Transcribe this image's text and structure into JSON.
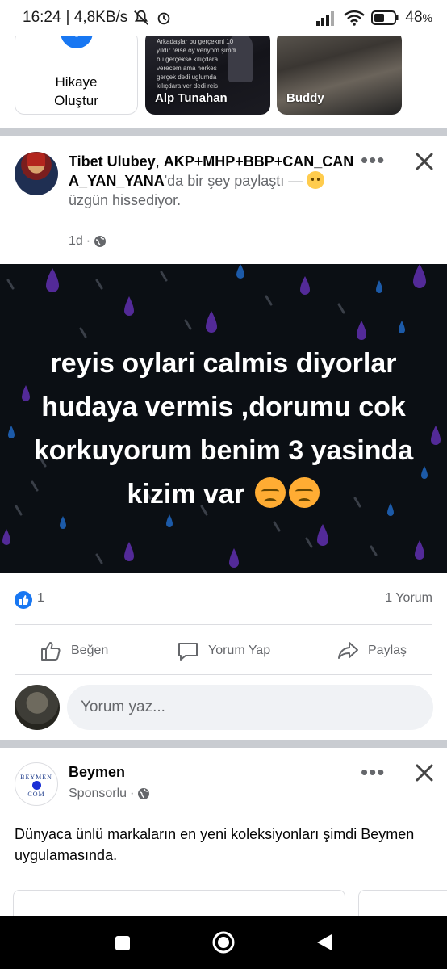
{
  "status_bar": {
    "time": "16:24",
    "speed": "| 4,8KB/s",
    "battery": "48",
    "battery_unit": "%"
  },
  "stories": {
    "create_line1": "Hikaye",
    "create_line2": "Oluştur",
    "items": [
      {
        "name": "Alp Tunahan",
        "overlay": "Arkadaşlar bu gerçekmi 10 yıldır reise oy veriyom şimdi bu gerçekse kılıçdara verecem ama herkes gerçek dedi uglumda kılıçdara ver dedi reis"
      },
      {
        "name": "Buddy"
      }
    ]
  },
  "post": {
    "author": "Tibet Ulubey",
    "author_suffix": ",",
    "page_name": "AKP+MHP+BBP+CAN_CANA_YAN_YANA",
    "shared_text": "'da bir şey paylaştı —",
    "feeling": "üzgün hissediyor.",
    "time": "1d",
    "separator": "·",
    "image_text": "reyis oylari calmis diyorlar hudaya vermis ,dorumu cok korkuyorum benim 3 yasinda kizim var",
    "reaction_count": "1",
    "comment_count": "1 Yorum",
    "actions": {
      "like": "Beğen",
      "comment": "Yorum Yap",
      "share": "Paylaş"
    },
    "comment_placeholder": "Yorum yaz..."
  },
  "sponsored": {
    "name": "Beymen",
    "label": "Sponsorlu",
    "separator": "·",
    "logo_text_top": "BEYMEN",
    "logo_text_bottom": "COM",
    "text": "Dünyaca ünlü markaların en yeni koleksiyonları şimdi Beymen uygulamasında."
  },
  "colors": {
    "accent": "#1877f2",
    "divider": "#c9ccd1",
    "muted_text": "#65676b",
    "post_bg": "#0b0f14"
  }
}
